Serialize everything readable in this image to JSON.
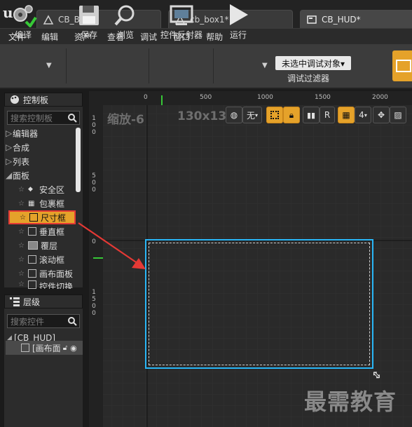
{
  "tabs": [
    {
      "label": "CB_Ball*"
    },
    {
      "label": "cb_box1*"
    },
    {
      "label": "CB_HUD*"
    }
  ],
  "menu": [
    "文件",
    "编辑",
    "资产",
    "查看",
    "调试",
    "窗口",
    "帮助"
  ],
  "toolbar": {
    "compile": "编译",
    "save": "保存",
    "browse": "浏览",
    "widget_reflector": "控件反射器",
    "run": "运行",
    "debug_select": "未选中调试对象▾",
    "debug_filter": "调试过滤器"
  },
  "palette": {
    "title": "控制板",
    "search_placeholder": "搜索控制板",
    "categories": [
      "编辑器",
      "合成",
      "列表",
      "面板"
    ],
    "items": [
      "安全区",
      "包裹框",
      "尺寸框",
      "垂直框",
      "覆层",
      "滚动框",
      "画布面板",
      "控件切换"
    ]
  },
  "hierarchy": {
    "title": "层级",
    "search_placeholder": "搜索控件",
    "root": "[CB_HUD]",
    "child": "[画布面"
  },
  "viewport": {
    "zoom": "缩放-6",
    "size": "130x139",
    "none_btn": "无",
    "r_btn": "R",
    "four_btn": "4",
    "ruler_top_ticks": [
      "0",
      "500",
      "1000",
      "1500",
      "2000"
    ],
    "ruler_left_ticks": [
      "100",
      "500",
      "0",
      "1500"
    ]
  },
  "watermark": "最需教育",
  "colors": {
    "accent_orange": "#e5a22a",
    "selection_blue": "#29b6f6",
    "highlight_red": "#e53935"
  }
}
